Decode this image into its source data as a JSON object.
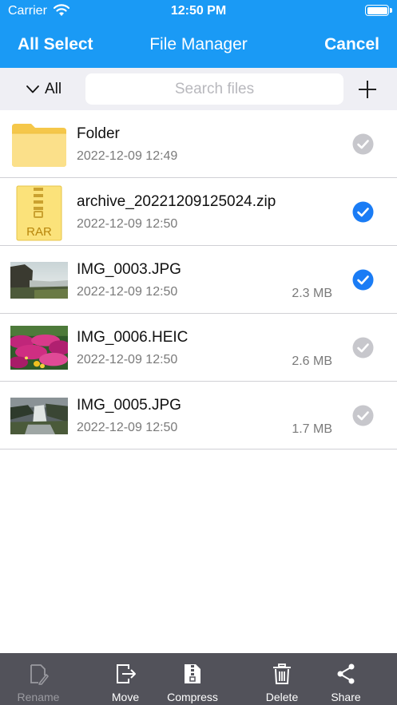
{
  "status_bar": {
    "carrier": "Carrier",
    "time": "12:50 PM"
  },
  "nav": {
    "left_label": "All Select",
    "title": "File Manager",
    "right_label": "Cancel"
  },
  "filter": {
    "label": "All"
  },
  "search": {
    "placeholder": "Search files",
    "value": ""
  },
  "files": [
    {
      "name": "Folder",
      "date": "2022-12-09 12:49",
      "size": "",
      "icon": "folder-icon",
      "selected": false
    },
    {
      "name": "archive_20221209125024.zip",
      "date": "2022-12-09 12:50",
      "size": "",
      "icon": "rar-archive-icon",
      "badge": "RAR",
      "selected": true
    },
    {
      "name": "IMG_0003.JPG",
      "date": "2022-12-09 12:50",
      "size": "2.3 MB",
      "icon": "image-thumbnail-coast",
      "selected": true
    },
    {
      "name": "IMG_0006.HEIC",
      "date": "2022-12-09 12:50",
      "size": "2.6 MB",
      "icon": "image-thumbnail-flowers",
      "selected": false
    },
    {
      "name": "IMG_0005.JPG",
      "date": "2022-12-09 12:50",
      "size": "1.7 MB",
      "icon": "image-thumbnail-waterfall",
      "selected": false
    }
  ],
  "toolbar": {
    "rename": {
      "label": "Rename",
      "icon": "rename-icon",
      "enabled": false
    },
    "move": {
      "label": "Move",
      "icon": "move-icon",
      "enabled": true
    },
    "compress": {
      "label": "Compress",
      "icon": "compress-icon",
      "enabled": true
    },
    "delete": {
      "label": "Delete",
      "icon": "trash-icon",
      "enabled": true
    },
    "share": {
      "label": "Share",
      "icon": "share-icon",
      "enabled": true
    }
  },
  "colors": {
    "accent": "#1a9af5",
    "selected_check": "#1a7cf5",
    "unselected_check": "#c7c7cc",
    "toolbar_bg": "#52525a",
    "search_bg": "#efeff4"
  }
}
